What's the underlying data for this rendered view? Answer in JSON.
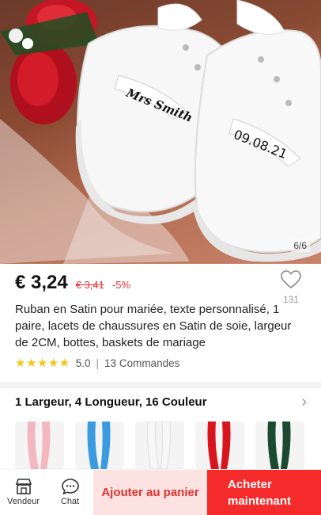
{
  "gallery": {
    "counter": "6/6",
    "shoe_left_text": "Mrs Smith",
    "shoe_right_text": "09.08.21"
  },
  "price": {
    "current": "€ 3,24",
    "original": "€ 3,41",
    "discount": "-5%"
  },
  "wishlist": {
    "count": "131",
    "icon": "heart-outline-icon"
  },
  "title": "Ruban en Satin pour mariée, texte personnalisé, 1 paire, lacets de chaussures en Satin de soie, largeur de 2CM, bottes, baskets de mariage",
  "rating": {
    "score": "5.0",
    "orders": "13 Commandes",
    "stars": 5
  },
  "variants": {
    "summary": "1 Largeur, 4 Longueur, 16 Couleur",
    "swatch_colors": [
      "#f3b8bf",
      "#3a9be0",
      "#f7f7f7",
      "#d8141c",
      "#1b4a30"
    ]
  },
  "bottom_bar": {
    "seller_label": "Vendeur",
    "chat_label": "Chat",
    "add_to_cart": "Ajouter au panier",
    "buy_now_line1": "Acheter",
    "buy_now_line2": "maintenant"
  },
  "colors": {
    "accent": "#f52a2a",
    "price_red": "#e33333",
    "star": "#f5c518"
  }
}
